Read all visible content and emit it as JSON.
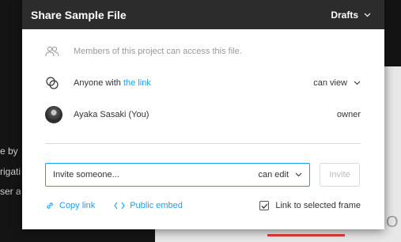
{
  "background": {
    "lines": [
      "e by c",
      "rigatio",
      "ser ac"
    ],
    "glyph": "O"
  },
  "dialog": {
    "title": "Share Sample File",
    "location": "Drafts",
    "members_text": "Members of this project can access this file.",
    "anyone_prefix": "Anyone with ",
    "anyone_link": "the link",
    "anyone_permission": "can view",
    "user_name": "Ayaka Sasaki (You)",
    "user_role": "owner",
    "invite_placeholder": "Invite someone...",
    "invite_permission": "can edit",
    "invite_button": "Invite",
    "copy_link": "Copy link",
    "public_embed": "Public embed",
    "link_selected_frame": "Link to selected frame",
    "link_selected_frame_checked": true
  },
  "colors": {
    "accent": "#18a0fb",
    "header_bg": "#2c2c2c"
  }
}
